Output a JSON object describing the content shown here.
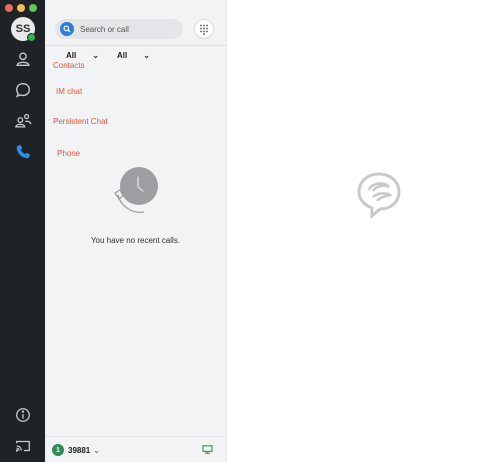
{
  "window": {
    "traffic_lights": [
      "#ed6a5e",
      "#f5bf4f",
      "#62c554"
    ]
  },
  "user": {
    "initials": "SS",
    "presence_color": "#35b04a"
  },
  "rail": {
    "icons": [
      "contacts-icon",
      "chat-icon",
      "group-icon",
      "phone-icon",
      "info-icon",
      "cast-icon"
    ],
    "active_color": "#2d8ee6"
  },
  "search": {
    "placeholder": "Search or call"
  },
  "filters": [
    {
      "label": "All"
    },
    {
      "label": "All"
    }
  ],
  "menu": {
    "items": [
      "Contacts",
      "IM chat",
      "Persistent Chat",
      "Phone"
    ],
    "color": "#e8543a"
  },
  "empty_state": {
    "message": "You have no recent calls."
  },
  "footer": {
    "extension": "39881",
    "badge": "1"
  }
}
